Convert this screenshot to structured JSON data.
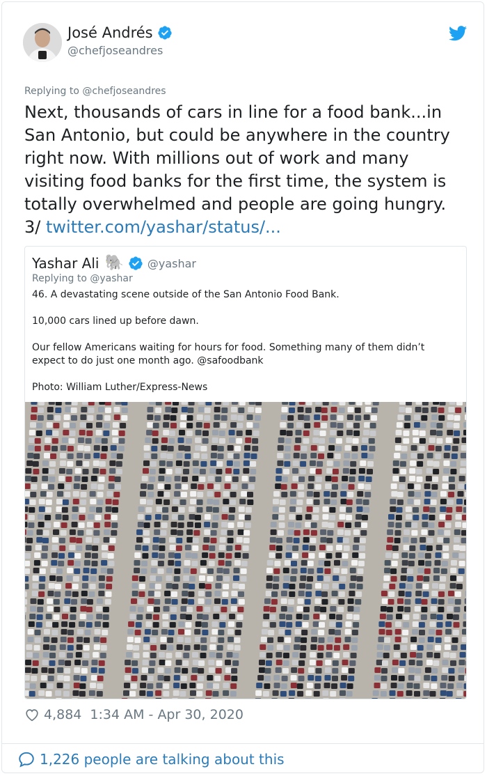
{
  "author": {
    "name": "José Andrés",
    "handle": "@chefjoseandres"
  },
  "replying_to": "Replying to @chefjoseandres",
  "tweet": {
    "text": "Next, thousands of cars in line for a food bank...in San Antonio, but could be anywhere in the country right now. With millions out of work and many visiting food banks for the first time, the system is totally overwhelmed and people are going hungry. 3/",
    "link": "twitter.com/yashar/status/..."
  },
  "quoted": {
    "name": "Yashar Ali",
    "emoji": "🐘",
    "handle": "@yashar",
    "replying_to": "Replying to @yashar",
    "paragraphs": [
      "46. A devastating scene outside of the San Antonio Food Bank.",
      "10,000 cars lined up before dawn.",
      "Our fellow Americans waiting for hours for food. Something many of them didn’t expect to do just one month ago. @safoodbank",
      "Photo: William Luther/Express-News"
    ]
  },
  "footer": {
    "likes": "4,884",
    "timestamp": "1:34 AM - Apr 30, 2020"
  },
  "talking": "1,226 people are talking about this",
  "colors": {
    "link": "#2b7bb9",
    "verified": "#1da1f2",
    "muted": "#697882",
    "border": "#e1e8ed"
  },
  "icons": [
    "verified-badge-icon",
    "twitter-bird-icon",
    "heart-icon",
    "speech-bubble-icon",
    "elephant-emoji"
  ]
}
